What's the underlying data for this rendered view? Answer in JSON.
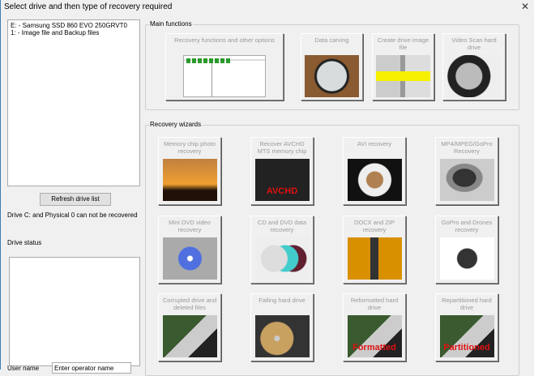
{
  "window": {
    "title": "Select drive and then type of recovery required",
    "close": "✕"
  },
  "drives": [
    "E: - Samsung  SSD 860 EVO 250GRVT0",
    "1: - Image file and Backup files"
  ],
  "refresh_label": "Refresh drive list",
  "warning": "Drive C: and Physical 0 can not be recovered",
  "drive_status_label": "Drive status",
  "user": {
    "label": "User name",
    "value": "Enter operator name"
  },
  "main": {
    "label": "Main functions",
    "items": [
      {
        "label": "Recovery functions and other options"
      },
      {
        "label": "Data carving"
      },
      {
        "label": "Create drive image file"
      },
      {
        "label": "Video Scan hard drive"
      }
    ]
  },
  "wizards": {
    "label": "Recovery wizards",
    "items": [
      {
        "label": "Memory chip photo recovery"
      },
      {
        "label": "Recover AVCHD MTS memory chip",
        "overlay": "AVCHD"
      },
      {
        "label": "AVI recovery"
      },
      {
        "label": "MP4/MPEG/GoPro Recovery"
      },
      {
        "label": "Mini DVD video recovery"
      },
      {
        "label": "CD and DVD data recovery"
      },
      {
        "label": "DOCX and ZIP recovery"
      },
      {
        "label": "GoPro and Drones recovery"
      },
      {
        "label": "Corrupted drive and deleted files"
      },
      {
        "label": "Failing hard drive"
      },
      {
        "label": "Reformatted hard drive",
        "overlay": "Formatted"
      },
      {
        "label": "Repartitioned hard drive",
        "overlay": "Partitioned"
      }
    ]
  }
}
